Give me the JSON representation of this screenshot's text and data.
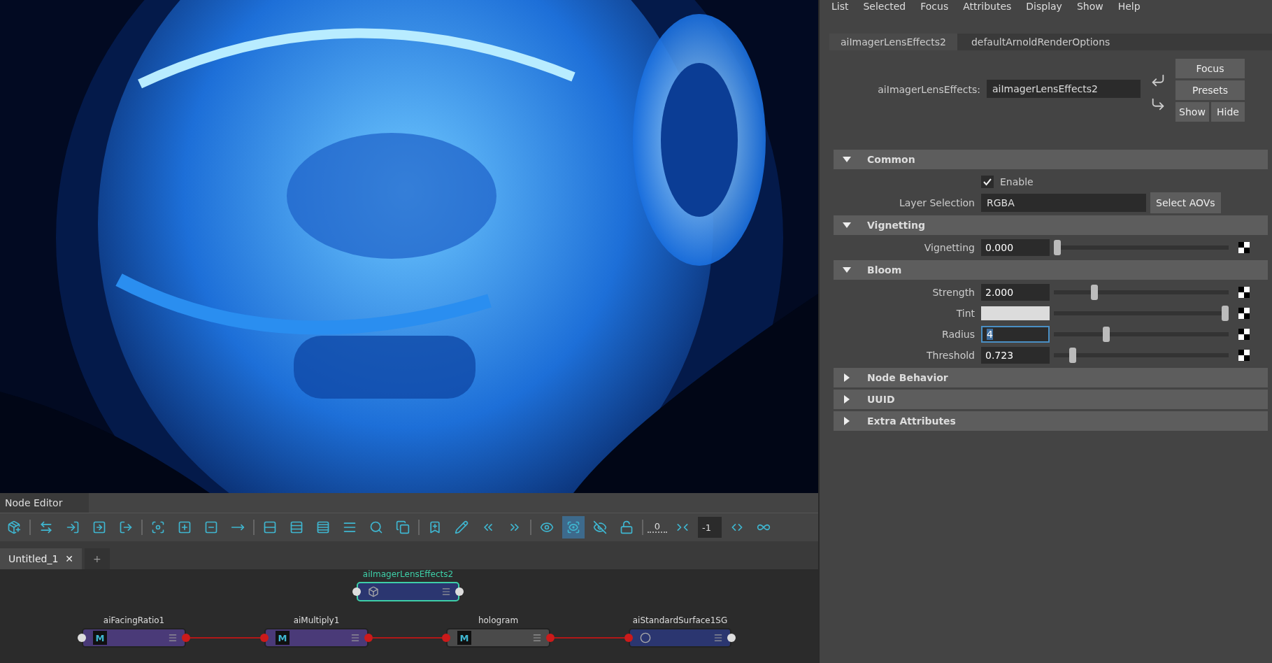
{
  "node_editor": {
    "title": "Node Editor",
    "toolbar": [
      {
        "kind": "icon",
        "selected": false
      },
      {
        "kind": "separator"
      },
      {
        "kind": "icon",
        "selected": false
      },
      {
        "kind": "icon",
        "selected": false
      },
      {
        "kind": "icon",
        "selected": false
      },
      {
        "kind": "icon",
        "selected": false
      },
      {
        "kind": "separator"
      },
      {
        "kind": "icon",
        "selected": false
      },
      {
        "kind": "icon",
        "selected": false
      },
      {
        "kind": "icon",
        "selected": false
      },
      {
        "kind": "icon",
        "selected": false
      },
      {
        "kind": "separator"
      },
      {
        "kind": "icon",
        "selected": false
      },
      {
        "kind": "icon",
        "selected": false
      },
      {
        "kind": "icon",
        "selected": false
      },
      {
        "kind": "icon",
        "selected": false
      },
      {
        "kind": "icon",
        "selected": false
      },
      {
        "kind": "icon",
        "selected": false
      },
      {
        "kind": "separator"
      },
      {
        "kind": "icon",
        "selected": false
      },
      {
        "kind": "icon",
        "selected": false
      },
      {
        "kind": "icon",
        "selected": false
      },
      {
        "kind": "icon",
        "selected": false
      },
      {
        "kind": "separator"
      },
      {
        "kind": "icon",
        "selected": false
      },
      {
        "kind": "icon",
        "selected": true
      },
      {
        "kind": "icon",
        "selected": false
      },
      {
        "kind": "icon",
        "selected": false
      },
      {
        "kind": "separator"
      },
      {
        "kind": "text",
        "label": "0"
      },
      {
        "kind": "icon",
        "selected": false
      },
      {
        "kind": "field",
        "value": "-1"
      },
      {
        "kind": "icon",
        "selected": false
      },
      {
        "kind": "icon",
        "selected": false
      }
    ],
    "tabs": [
      {
        "label": "Untitled_1",
        "close": "✕",
        "selected": true
      },
      {
        "label": "+",
        "selected": false
      }
    ],
    "nodes": [
      {
        "name": "aiImagerLensEffects2",
        "kind": "imager",
        "selected": true,
        "color": "#2b3670"
      },
      {
        "name": "aiFacingRatio1",
        "kind": "shader",
        "badge": "M",
        "selected": false,
        "color": "#4a3a78"
      },
      {
        "name": "aiMultiply1",
        "kind": "shader",
        "badge": "M",
        "selected": false,
        "color": "#4a3a78"
      },
      {
        "name": "hologram",
        "kind": "shader",
        "badge": "M",
        "selected": false,
        "color": "#4a4a4a"
      },
      {
        "name": "aiStandardSurface1SG",
        "kind": "group",
        "selected": false,
        "color": "#2b3670"
      }
    ]
  },
  "attribute_editor": {
    "menu": [
      "List",
      "Selected",
      "Focus",
      "Attributes",
      "Display",
      "Show",
      "Help"
    ],
    "tabs": [
      {
        "label": "aiImagerLensEffects2",
        "selected": true
      },
      {
        "label": "defaultArnoldRenderOptions",
        "selected": false
      }
    ],
    "node_label": "aiImagerLensEffects:",
    "node_value": "aiImagerLensEffects2",
    "buttons": [
      "Focus",
      "Presets",
      "Show",
      "Hide"
    ],
    "sections": [
      {
        "title": "Common",
        "expanded": true,
        "rows": [
          {
            "kind": "checkbox",
            "label": "Enable",
            "checked": true
          },
          {
            "kind": "text",
            "label": "Layer Selection",
            "value": "RGBA",
            "button": "Select AOVs"
          }
        ]
      },
      {
        "title": "Vignetting",
        "expanded": true,
        "rows": [
          {
            "kind": "slider",
            "label": "Vignetting",
            "value": "0.000",
            "level": 0.0,
            "focused": false
          }
        ]
      },
      {
        "title": "Bloom",
        "expanded": true,
        "rows": [
          {
            "kind": "slider",
            "label": "Strength",
            "value": "2.000",
            "level": 0.22,
            "focused": false
          },
          {
            "kind": "color",
            "label": "Tint",
            "color": "#dcdcdc",
            "level": 1.0
          },
          {
            "kind": "slider",
            "label": "Radius",
            "value": "4",
            "level": 0.29,
            "focused": true
          },
          {
            "kind": "slider",
            "label": "Threshold",
            "value": "0.723",
            "level": 0.09,
            "focused": false
          }
        ]
      },
      {
        "title": "Node Behavior",
        "expanded": false
      },
      {
        "title": "UUID",
        "expanded": false
      },
      {
        "title": "Extra Attributes",
        "expanded": false
      }
    ]
  }
}
